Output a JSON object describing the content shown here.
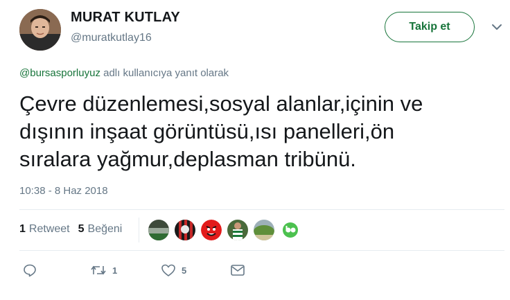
{
  "author": {
    "name": "MURAT KUTLAY",
    "handle": "@muratkutlay16"
  },
  "follow_button": "Takip et",
  "reply": {
    "mention": "@bursasporluyuz",
    "suffix": " adlı kullanıcıya yanıt olarak"
  },
  "tweet_text": "Çevre düzenlemesi,sosyal alanlar,içinin ve\ndışının inşaat görüntüsü,ısı panelleri,ön\nsıralara yağmur,deplasman tribünü.",
  "timestamp": "10:38 - 8 Haz 2018",
  "stats": {
    "retweet_count": "1",
    "retweet_label": "Retweet",
    "like_count": "5",
    "like_label": "Beğeni"
  },
  "actions": {
    "retweet_count": "1",
    "like_count": "5"
  },
  "colors": {
    "accent": "#17743a",
    "muted": "#657786",
    "divider": "#e6ecf0"
  }
}
